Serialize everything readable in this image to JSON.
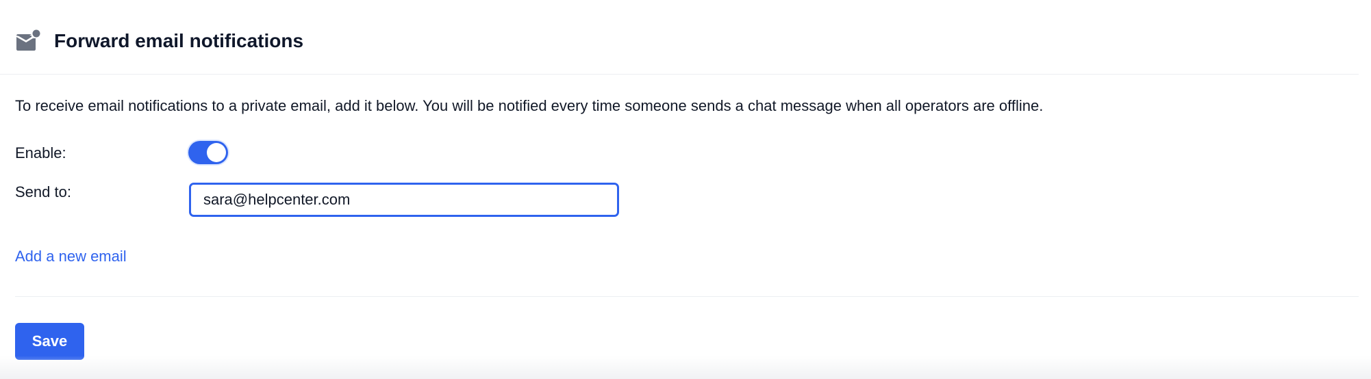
{
  "header": {
    "title": "Forward email notifications",
    "icon": "envelope-badge-icon"
  },
  "description": "To receive email notifications to a private email, add it below. You will be notified every time someone sends a chat message when all operators are offline.",
  "form": {
    "enable_label": "Enable:",
    "enabled": true,
    "send_to_label": "Send to:",
    "email_value": "sara@helpcenter.com",
    "add_email_label": "Add a new email"
  },
  "actions": {
    "save_label": "Save"
  },
  "colors": {
    "accent": "#2f63ee",
    "icon": "#6b7280",
    "text": "#111827"
  }
}
